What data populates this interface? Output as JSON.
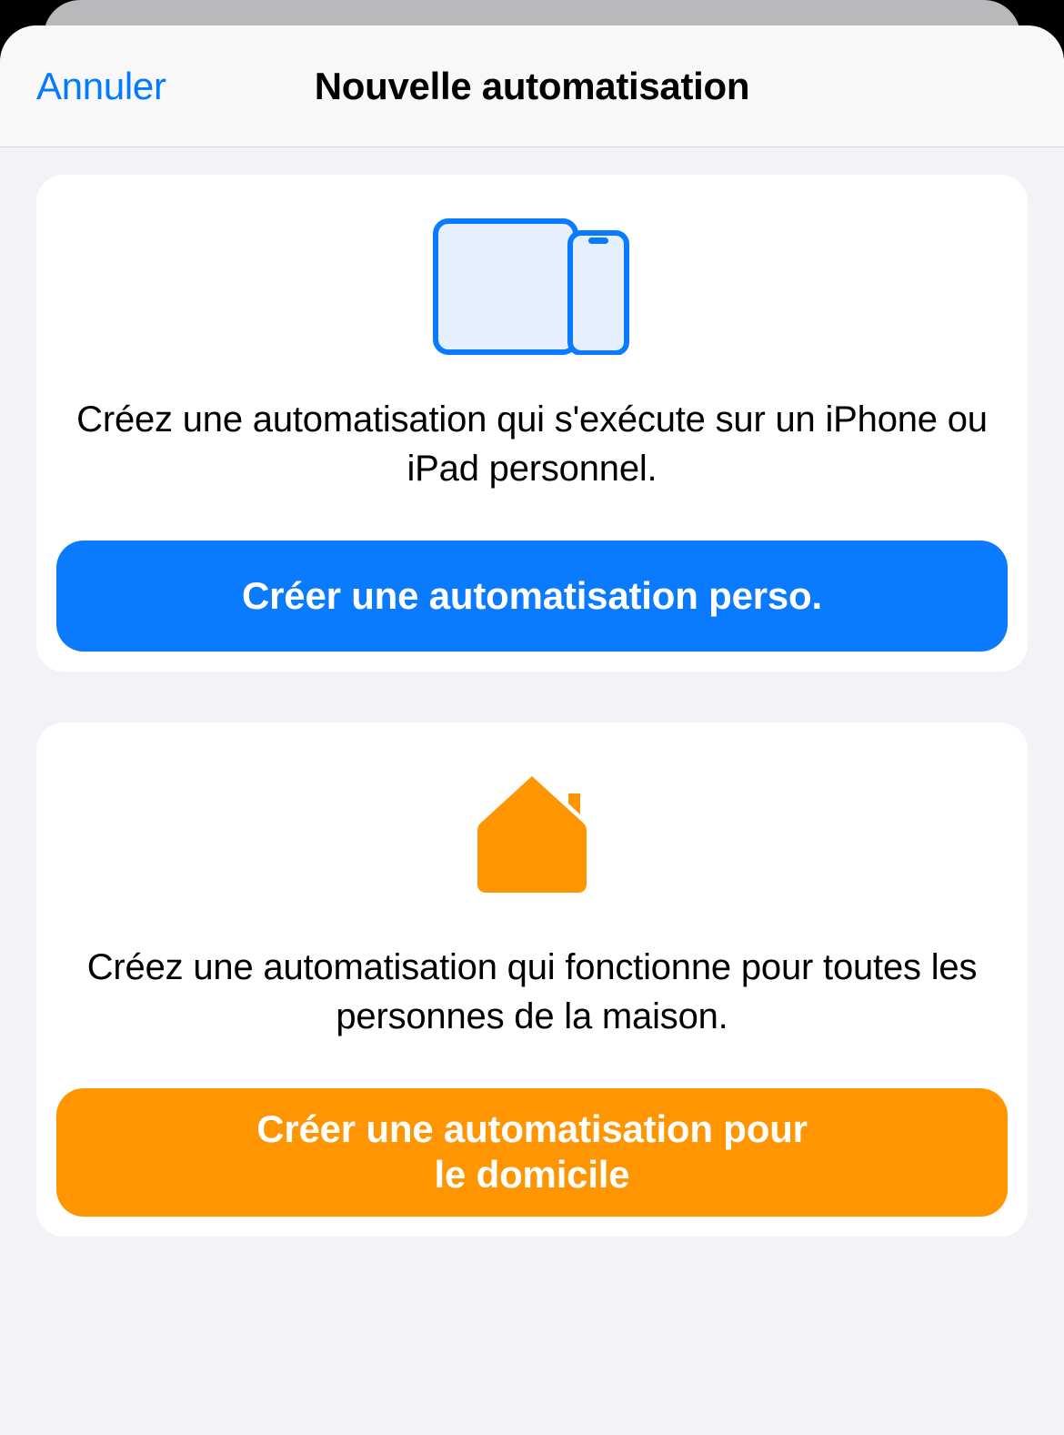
{
  "nav": {
    "cancel": "Annuler",
    "title": "Nouvelle automatisation"
  },
  "personal": {
    "icon": "devices-icon",
    "description": "Créez une automatisation qui s'exécute sur un iPhone ou iPad personnel.",
    "button": "Créer une automatisation perso."
  },
  "home": {
    "icon": "home-icon",
    "description": "Créez une automatisation qui fonctionne pour toutes les personnes de la maison.",
    "button": "Créer une automatisation pour\nle domicile"
  },
  "colors": {
    "accent_blue": "#0a7aff",
    "accent_orange": "#ff9500",
    "device_fill": "#e5efff"
  }
}
